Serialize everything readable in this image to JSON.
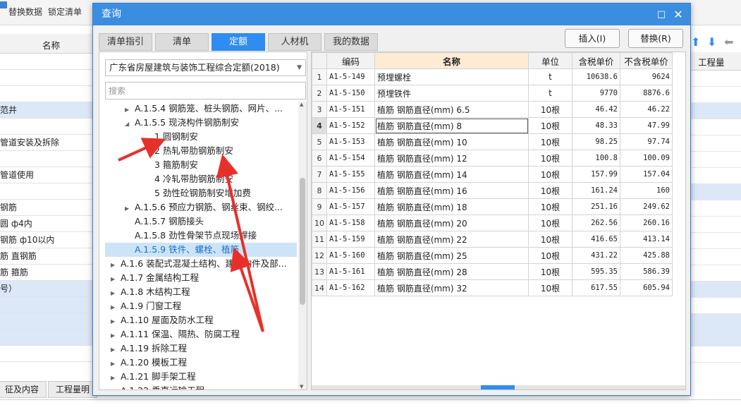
{
  "app": {
    "toolbar": {
      "replace_data": "替换数据",
      "lock_list": "锁定清单"
    },
    "name_header": "名称",
    "quantity_header": "工程量",
    "left_rows": [
      "",
      "",
      "",
      "范井",
      "",
      "管道安装及拆除",
      "",
      "管道使用",
      "",
      "钢筋",
      "圆 ф4内",
      "钢筋 ф10以内",
      "筋 直钢筋",
      "筋 箍筋",
      "号）",
      "",
      "",
      "",
      ""
    ],
    "bottom_tabs": [
      "征及内容",
      "工程量明"
    ]
  },
  "dialog": {
    "title": "查询",
    "tabs": [
      "清单指引",
      "清单",
      "定额",
      "人材机",
      "我的数据"
    ],
    "active_tab": 2,
    "insert_button": "插入(I)",
    "replace_button": "替换(R)",
    "quota_select": "广东省房屋建筑与装饰工程综合定额(2018)",
    "search_placeholder": "搜索",
    "tree": [
      {
        "label": "A.1.5.4 钢筋笼、桩头钢筋、网片、...",
        "level": 2,
        "arrow": "collapsed"
      },
      {
        "label": "A.1.5.5 现浇构件钢筋制安",
        "level": 2,
        "arrow": "expanded"
      },
      {
        "label": "1 圆钢制安",
        "level": 3,
        "arrow": "none"
      },
      {
        "label": "2 热轧带肋钢筋制安",
        "level": 3,
        "arrow": "none"
      },
      {
        "label": "3 箍筋制安",
        "level": 3,
        "arrow": "none"
      },
      {
        "label": "4 冷轧带肋钢筋制安",
        "level": 3,
        "arrow": "none"
      },
      {
        "label": "5 劲性砼钢筋制安增加费",
        "level": 3,
        "arrow": "none"
      },
      {
        "label": "A.1.5.6 预应力钢筋、钢丝束、钢绞...",
        "level": 2,
        "arrow": "collapsed"
      },
      {
        "label": "A.1.5.7 钢筋接头",
        "level": 2,
        "arrow": "none"
      },
      {
        "label": "A.1.5.8 劲性骨架节点现场焊接",
        "level": 2,
        "arrow": "none"
      },
      {
        "label": "A.1.5.9 铁件、螺栓、植筋",
        "level": 2,
        "arrow": "none",
        "selected": true
      },
      {
        "label": "A.1.6 装配式混凝土结构、建筑构件及部...",
        "level": 1,
        "arrow": "collapsed"
      },
      {
        "label": "A.1.7 金属结构工程",
        "level": 1,
        "arrow": "collapsed"
      },
      {
        "label": "A.1.8 木结构工程",
        "level": 1,
        "arrow": "collapsed"
      },
      {
        "label": "A.1.9 门窗工程",
        "level": 1,
        "arrow": "collapsed"
      },
      {
        "label": "A.1.10 屋面及防水工程",
        "level": 1,
        "arrow": "collapsed"
      },
      {
        "label": "A.1.11 保温、隔热、防腐工程",
        "level": 1,
        "arrow": "collapsed"
      },
      {
        "label": "A.1.19 拆除工程",
        "level": 1,
        "arrow": "collapsed"
      },
      {
        "label": "A.1.20 模板工程",
        "level": 1,
        "arrow": "collapsed"
      },
      {
        "label": "A.1.21 脚手架工程",
        "level": 1,
        "arrow": "collapsed"
      },
      {
        "label": "A.1.22 垂直运输工程",
        "level": 1,
        "arrow": "collapsed"
      }
    ],
    "table": {
      "headers": [
        "",
        "编码",
        "名称",
        "单位",
        "含税单价",
        "不含税单价"
      ],
      "current_row": 4,
      "rows": [
        [
          "1",
          "A1-5-149",
          "预埋螺栓",
          "t",
          "10638.6",
          "9624"
        ],
        [
          "2",
          "A1-5-150",
          "预埋铁件",
          "t",
          "9770",
          "8876.6"
        ],
        [
          "3",
          "A1-5-151",
          "植筋 钢筋直径(mm) 6.5",
          "10根",
          "46.42",
          "46.22"
        ],
        [
          "4",
          "A1-5-152",
          "植筋 钢筋直径(mm) 8",
          "10根",
          "48.33",
          "47.99"
        ],
        [
          "5",
          "A1-5-153",
          "植筋 钢筋直径(mm) 10",
          "10根",
          "98.25",
          "97.74"
        ],
        [
          "6",
          "A1-5-154",
          "植筋 钢筋直径(mm) 12",
          "10根",
          "100.8",
          "100.09"
        ],
        [
          "7",
          "A1-5-155",
          "植筋 钢筋直径(mm) 14",
          "10根",
          "157.99",
          "157.04"
        ],
        [
          "8",
          "A1-5-156",
          "植筋 钢筋直径(mm) 16",
          "10根",
          "161.24",
          "160"
        ],
        [
          "9",
          "A1-5-157",
          "植筋 钢筋直径(mm) 18",
          "10根",
          "251.16",
          "249.62"
        ],
        [
          "10",
          "A1-5-158",
          "植筋 钢筋直径(mm) 20",
          "10根",
          "262.56",
          "260.16"
        ],
        [
          "11",
          "A1-5-159",
          "植筋 钢筋直径(mm) 22",
          "10根",
          "416.65",
          "413.14"
        ],
        [
          "12",
          "A1-5-160",
          "植筋 钢筋直径(mm) 25",
          "10根",
          "431.22",
          "425.88"
        ],
        [
          "13",
          "A1-5-161",
          "植筋 钢筋直径(mm) 28",
          "10根",
          "595.35",
          "586.39"
        ],
        [
          "14",
          "A1-5-162",
          "植筋 钢筋直径(mm) 32",
          "10根",
          "617.55",
          "605.94"
        ]
      ]
    }
  },
  "colors": {
    "title_bar": "#3b8de0",
    "active_tab": "#2f8cf0",
    "selection": "#cce4f7",
    "name_header": "#fdebd3",
    "annotation_arrow": "#e8302a"
  }
}
